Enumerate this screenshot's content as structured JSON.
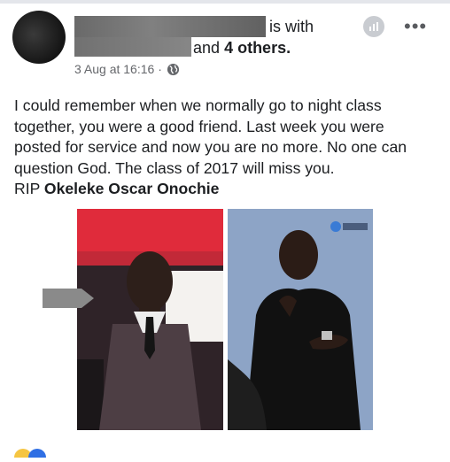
{
  "post": {
    "header": {
      "name_suffix": "is with",
      "and_text": "and",
      "others_text": "4 others.",
      "timestamp": "3 Aug at 16:16 ·"
    },
    "icons": {
      "globe": "globe-icon",
      "stats": "insights-icon",
      "more": "more-options-icon"
    },
    "text": {
      "line1": "I could remember when we normally go to night class",
      "line2": "together, you were a good friend. Last week you were",
      "line3": "posted for service and now you are no more. No one can",
      "line4": "question God. The class of 2017 will miss you.",
      "rip_prefix": "RIP",
      "rip_name": "Okeleke Oscar Onochie"
    }
  },
  "colors": {
    "text": "#1c1e21",
    "secondary": "#65676b",
    "icon_gray": "#c9ccd1"
  }
}
